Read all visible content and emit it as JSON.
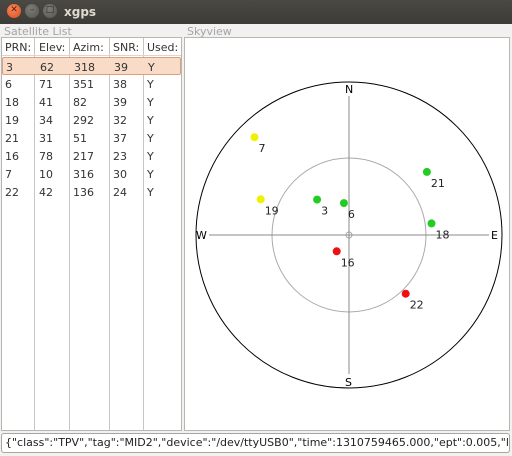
{
  "window": {
    "title": "xgps"
  },
  "satellite_list": {
    "label": "Satellite List",
    "columns": [
      "PRN:",
      "Elev:",
      "Azim:",
      "SNR:",
      "Used:"
    ],
    "selected_index": 0,
    "rows": [
      [
        "3",
        "62",
        "318",
        "39",
        "Y"
      ],
      [
        "6",
        "71",
        "351",
        "38",
        "Y"
      ],
      [
        "18",
        "41",
        "82",
        "39",
        "Y"
      ],
      [
        "19",
        "34",
        "292",
        "32",
        "Y"
      ],
      [
        "21",
        "31",
        "51",
        "37",
        "Y"
      ],
      [
        "16",
        "78",
        "217",
        "23",
        "Y"
      ],
      [
        "7",
        "10",
        "316",
        "30",
        "Y"
      ],
      [
        "22",
        "42",
        "136",
        "24",
        "Y"
      ]
    ]
  },
  "skyview": {
    "label": "Skyview",
    "directions": {
      "north": "N",
      "south": "S",
      "east": "E",
      "west": "W"
    },
    "satellites": [
      {
        "prn": "3",
        "elev": 62,
        "azim": 318,
        "color": "#22cc22"
      },
      {
        "prn": "6",
        "elev": 71,
        "azim": 351,
        "color": "#22cc22"
      },
      {
        "prn": "18",
        "elev": 41,
        "azim": 82,
        "color": "#22cc22"
      },
      {
        "prn": "19",
        "elev": 34,
        "azim": 292,
        "color": "#f0f000"
      },
      {
        "prn": "21",
        "elev": 31,
        "azim": 51,
        "color": "#22cc22"
      },
      {
        "prn": "16",
        "elev": 78,
        "azim": 217,
        "color": "#ee1111"
      },
      {
        "prn": "7",
        "elev": 10,
        "azim": 316,
        "color": "#f0f000"
      },
      {
        "prn": "22",
        "elev": 42,
        "azim": 136,
        "color": "#ee1111"
      }
    ]
  },
  "status": {
    "text": "{\"class\":\"TPV\",\"tag\":\"MID2\",\"device\":\"/dev/ttyUSB0\",\"time\":1310759465.000,\"ept\":0.005,\"lat\":"
  },
  "colors": {
    "selected_row": "#f9dcc8",
    "selected_border": "#e49d7a",
    "titlebar": "#3c3b37",
    "close_button": "#de4b1a"
  }
}
